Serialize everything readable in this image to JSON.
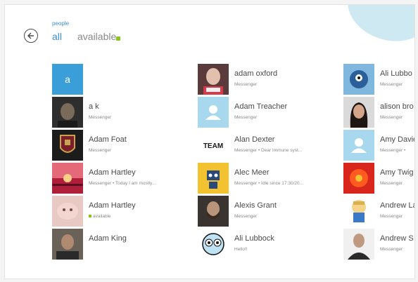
{
  "header": {
    "section_label": "people",
    "filter_all": "all",
    "filter_available": "available"
  },
  "columns": [
    [
      {
        "name": "",
        "status": "",
        "avatar": "letter",
        "letter": "a"
      },
      {
        "name": "a k",
        "status": "Messenger",
        "avatar": "photo-dark"
      },
      {
        "name": "Adam Foat",
        "status": "Messenger",
        "avatar": "badge"
      },
      {
        "name": "Adam Hartley",
        "status": "Messenger • Today I am mostly...",
        "avatar": "sunset"
      },
      {
        "name": "Adam Hartley",
        "status": "available",
        "avatar": "baby"
      },
      {
        "name": "Adam King",
        "status": "",
        "avatar": "photo-man"
      }
    ],
    [
      {
        "name": "adam oxford",
        "status": "Messenger",
        "avatar": "bald"
      },
      {
        "name": "Adam Treacher",
        "status": "Messenger",
        "avatar": "default"
      },
      {
        "name": "Alan Dexter",
        "status": "Messenger • Dear Immune syst...",
        "avatar": "text",
        "avatar_text": "TEAM"
      },
      {
        "name": "Alec Meer",
        "status": "Messenger • Idle since 17:30/20...",
        "avatar": "robot"
      },
      {
        "name": "Alexis Grant",
        "status": "Messenger",
        "avatar": "photo-beard"
      },
      {
        "name": "Ali Lubbock",
        "status": "Hello!!",
        "avatar": "cartoon"
      }
    ],
    [
      {
        "name": "Ali Lubbo",
        "status": "Messenger",
        "avatar": "monster"
      },
      {
        "name": "alison bro",
        "status": "Messenger",
        "avatar": "photo-woman"
      },
      {
        "name": "Amy Davie",
        "status": "Messenger •",
        "avatar": "default"
      },
      {
        "name": "Amy Twig",
        "status": "Messenger",
        "avatar": "flower"
      },
      {
        "name": "Andrew La",
        "status": "Messenger",
        "avatar": "southpark"
      },
      {
        "name": "Andrew S",
        "status": "Messenger",
        "avatar": "photo-suit"
      }
    ]
  ],
  "colors": {
    "accent": "#3a8fd4",
    "tile_blue": "#3a9ed8",
    "available_green": "#8fc31f",
    "default_avatar": "#a8d8ee"
  }
}
